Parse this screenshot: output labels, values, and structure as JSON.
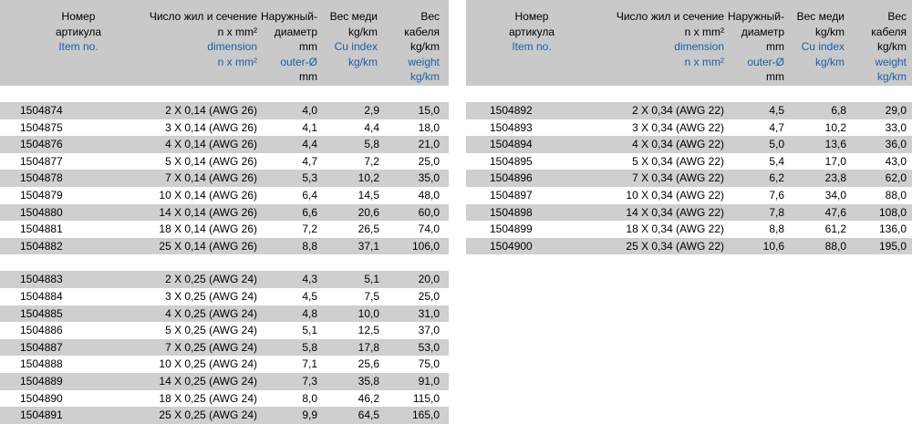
{
  "header": {
    "item": {
      "ru": [
        "Номер",
        "артикула"
      ],
      "en": [
        "Item no."
      ]
    },
    "dim": {
      "ru": [
        "Число жил и сечение",
        "n x mm²"
      ],
      "en": [
        "dimension",
        "n x mm²"
      ]
    },
    "od": {
      "ru": [
        "Наружный-",
        "диаметр",
        "mm"
      ],
      "en": [
        "outer-Ø"
      ],
      "unit2": "mm"
    },
    "cu": {
      "ru": [
        "Вес меди",
        "kg/km"
      ],
      "en": [
        "Cu index",
        "kg/km"
      ]
    },
    "wt": {
      "ru": [
        "Вес",
        "кабеля",
        "kg/km"
      ],
      "en": [
        "weight",
        "kg/km"
      ]
    }
  },
  "left": {
    "groups": [
      [
        [
          "1504874",
          "2 X 0,14 (AWG 26)",
          "4,0",
          "2,9",
          "15,0"
        ],
        [
          "1504875",
          "3 X 0,14 (AWG 26)",
          "4,1",
          "4,4",
          "18,0"
        ],
        [
          "1504876",
          "4 X 0,14 (AWG 26)",
          "4,4",
          "5,8",
          "21,0"
        ],
        [
          "1504877",
          "5 X 0,14 (AWG 26)",
          "4,7",
          "7,2",
          "25,0"
        ],
        [
          "1504878",
          "7 X 0,14 (AWG 26)",
          "5,3",
          "10,2",
          "35,0"
        ],
        [
          "1504879",
          "10 X 0,14 (AWG 26)",
          "6,4",
          "14,5",
          "48,0"
        ],
        [
          "1504880",
          "14 X 0,14 (AWG 26)",
          "6,6",
          "20,6",
          "60,0"
        ],
        [
          "1504881",
          "18 X 0,14 (AWG 26)",
          "7,2",
          "26,5",
          "74,0"
        ],
        [
          "1504882",
          "25 X 0,14 (AWG 26)",
          "8,8",
          "37,1",
          "106,0"
        ]
      ],
      [
        [
          "1504883",
          "2 X 0,25 (AWG 24)",
          "4,3",
          "5,1",
          "20,0"
        ],
        [
          "1504884",
          "3 X 0,25 (AWG 24)",
          "4,5",
          "7,5",
          "25,0"
        ],
        [
          "1504885",
          "4 X 0,25 (AWG 24)",
          "4,8",
          "10,0",
          "31,0"
        ],
        [
          "1504886",
          "5 X 0,25 (AWG 24)",
          "5,1",
          "12,5",
          "37,0"
        ],
        [
          "1504887",
          "7 X 0,25 (AWG 24)",
          "5,8",
          "17,8",
          "53,0"
        ],
        [
          "1504888",
          "10 X 0,25 (AWG 24)",
          "7,1",
          "25,6",
          "75,0"
        ],
        [
          "1504889",
          "14 X 0,25 (AWG 24)",
          "7,3",
          "35,8",
          "91,0"
        ],
        [
          "1504890",
          "18 X 0,25 (AWG 24)",
          "8,0",
          "46,2",
          "115,0"
        ],
        [
          "1504891",
          "25 X 0,25 (AWG 24)",
          "9,9",
          "64,5",
          "165,0"
        ]
      ]
    ]
  },
  "right": {
    "groups": [
      [
        [
          "1504892",
          "2 X 0,34 (AWG 22)",
          "4,5",
          "6,8",
          "29,0"
        ],
        [
          "1504893",
          "3 X 0,34 (AWG 22)",
          "4,7",
          "10,2",
          "33,0"
        ],
        [
          "1504894",
          "4 X 0,34 (AWG 22)",
          "5,0",
          "13,6",
          "36,0"
        ],
        [
          "1504895",
          "5 X 0,34 (AWG 22)",
          "5,4",
          "17,0",
          "43,0"
        ],
        [
          "1504896",
          "7 X 0,34 (AWG 22)",
          "6,2",
          "23,8",
          "62,0"
        ],
        [
          "1504897",
          "10 X 0,34 (AWG 22)",
          "7,6",
          "34,0",
          "88,0"
        ],
        [
          "1504898",
          "14 X 0,34 (AWG 22)",
          "7,8",
          "47,6",
          "108,0"
        ],
        [
          "1504899",
          "18 X 0,34 (AWG 22)",
          "8,8",
          "61,2",
          "136,0"
        ],
        [
          "1504900",
          "25 X 0,34 (AWG 22)",
          "10,6",
          "88,0",
          "195,0"
        ]
      ]
    ]
  }
}
